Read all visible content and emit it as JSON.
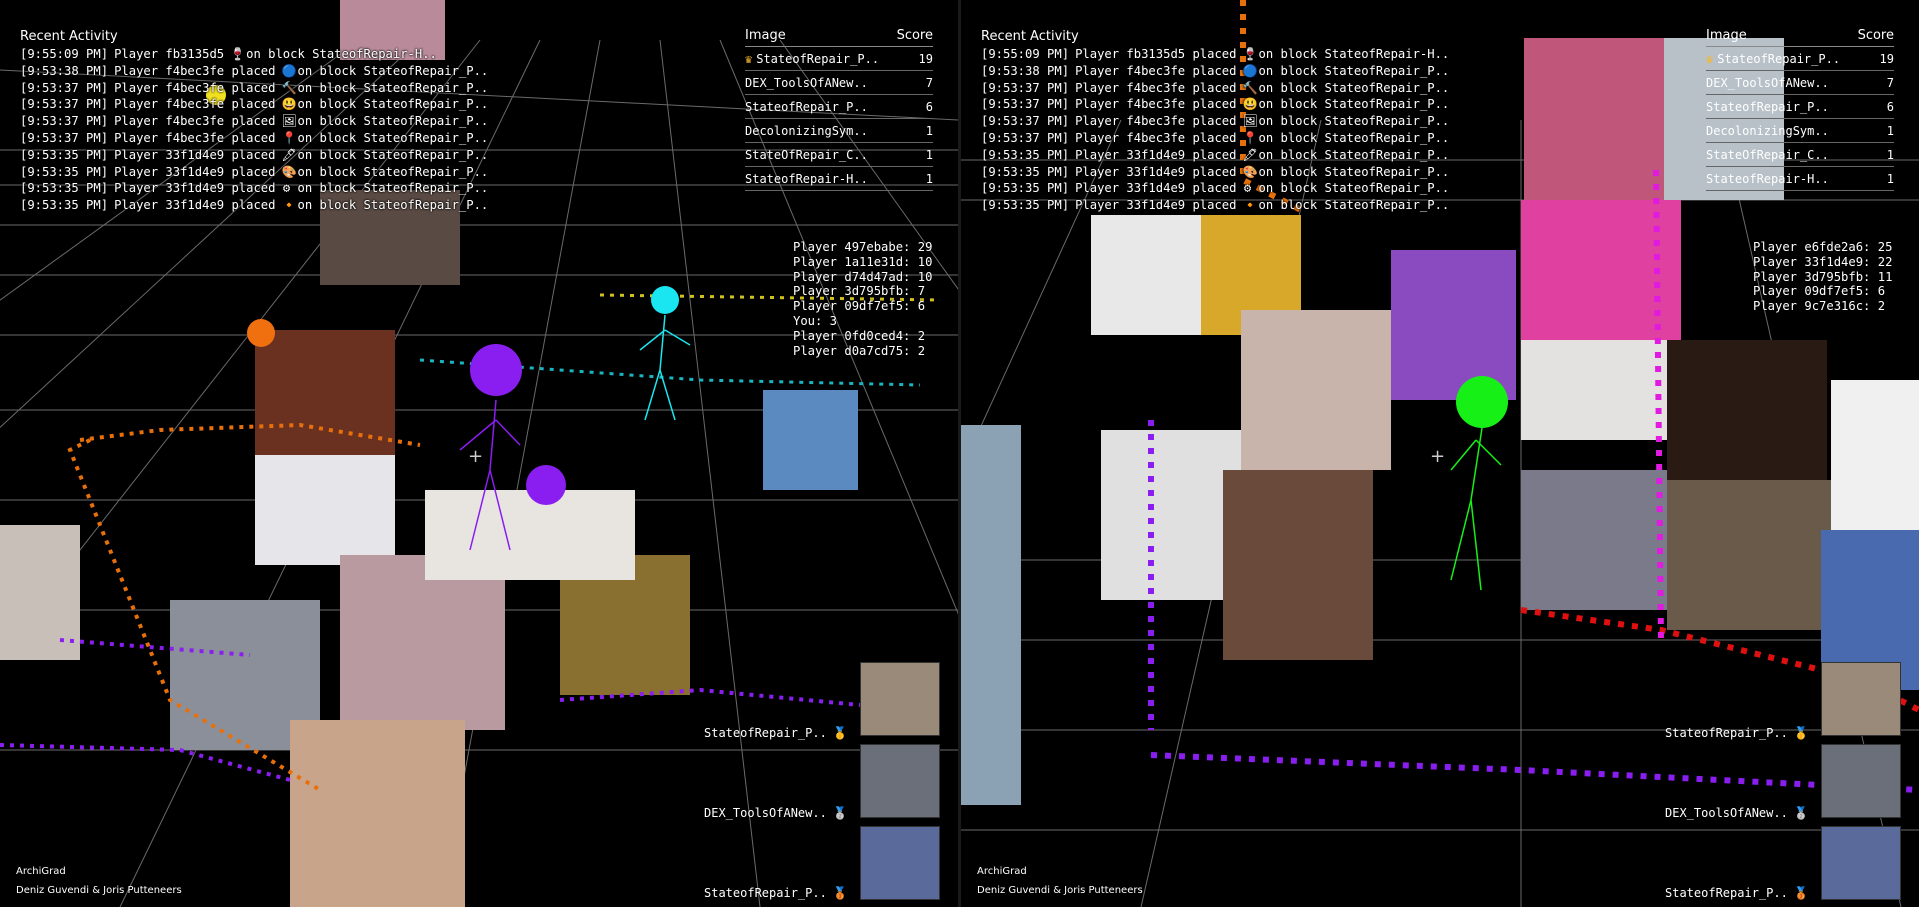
{
  "panes": [
    {
      "id": "left",
      "activity_title": "Recent Activity",
      "activity": [
        {
          "time": "[9:55:09 PM]",
          "player": "Player fb3135d5",
          "icon": "🍷",
          "block": "on block StateofRepair-H.."
        },
        {
          "time": "[9:53:38 PM]",
          "player": "Player f4bec3fe placed",
          "icon": "🔵",
          "block": "on block StateofRepair_P.."
        },
        {
          "time": "[9:53:37 PM]",
          "player": "Player f4bec3fe placed",
          "icon": "🔨",
          "block": "on block StateofRepair_P.."
        },
        {
          "time": "[9:53:37 PM]",
          "player": "Player f4bec3fe placed",
          "icon": "😃",
          "block": "on block StateofRepair_P.."
        },
        {
          "time": "[9:53:37 PM]",
          "player": "Player f4bec3fe placed",
          "icon": "🖼",
          "block": "on block StateofRepair_P.."
        },
        {
          "time": "[9:53:37 PM]",
          "player": "Player f4bec3fe placed",
          "icon": "📍",
          "block": "on block StateofRepair_P.."
        },
        {
          "time": "[9:53:35 PM]",
          "player": "Player 33f1d4e9 placed",
          "icon": "🖋",
          "block": "on block StateofRepair_P.."
        },
        {
          "time": "[9:53:35 PM]",
          "player": "Player 33f1d4e9 placed",
          "icon": "🎨",
          "block": "on block StateofRepair_P.."
        },
        {
          "time": "[9:53:35 PM]",
          "player": "Player 33f1d4e9 placed",
          "icon": "⚙",
          "block": "on block StateofRepair_P.."
        },
        {
          "time": "[9:53:35 PM]",
          "player": "Player 33f1d4e9 placed",
          "icon": "🔸",
          "block": "on block StateofRepair_P.."
        }
      ],
      "scoreboard": {
        "col_image": "Image",
        "col_score": "Score",
        "rows": [
          {
            "name": "StateofRepair_P..",
            "score": "19",
            "crown": true
          },
          {
            "name": "DEX_ToolsOfANew..",
            "score": "7",
            "crown": false
          },
          {
            "name": "StateofRepair_P..",
            "score": "6",
            "crown": false
          },
          {
            "name": "DecolonizingSym..",
            "score": "1",
            "crown": false
          },
          {
            "name": "StateOfRepair_C..",
            "score": "1",
            "crown": false
          },
          {
            "name": "StateofRepair-H..",
            "score": "1",
            "crown": false
          }
        ]
      },
      "players": [
        "Player 497ebabe: 29",
        "Player 1a11e31d: 10",
        "Player d74d47ad: 10",
        "Player 3d795bfb: 7",
        "Player 09df7ef5: 6",
        "You: 3",
        "Player 0fd0ced4: 2",
        "Player d0a7cd75: 2"
      ],
      "top_images": [
        {
          "label": "StateofRepair_P..",
          "medal": "🥇"
        },
        {
          "label": "DEX_ToolsOfANew..",
          "medal": "🥈"
        },
        {
          "label": "StateofRepair_P..",
          "medal": "🥉"
        }
      ],
      "credits": {
        "app": "ArchiGrad",
        "authors": "Deniz Guvendi & Joris Putteneers"
      },
      "crosshair": "+"
    },
    {
      "id": "right",
      "activity_title": "Recent Activity",
      "activity": [
        {
          "time": "[9:55:09 PM]",
          "player": "Player fb3135d5 placed",
          "icon": "🍷",
          "block": "on block StateofRepair-H.."
        },
        {
          "time": "[9:53:38 PM]",
          "player": "Player f4bec3fe placed",
          "icon": "🔵",
          "block": "on block StateofRepair_P.."
        },
        {
          "time": "[9:53:37 PM]",
          "player": "Player f4bec3fe placed",
          "icon": "🔨",
          "block": "on block StateofRepair_P.."
        },
        {
          "time": "[9:53:37 PM]",
          "player": "Player f4bec3fe placed",
          "icon": "😃",
          "block": "on block StateofRepair_P.."
        },
        {
          "time": "[9:53:37 PM]",
          "player": "Player f4bec3fe placed",
          "icon": "🖼",
          "block": "on block StateofRepair_P.."
        },
        {
          "time": "[9:53:37 PM]",
          "player": "Player f4bec3fe placed",
          "icon": "📍",
          "block": "on block StateofRepair_P.."
        },
        {
          "time": "[9:53:35 PM]",
          "player": "Player 33f1d4e9 placed",
          "icon": "🖋",
          "block": "on block StateofRepair_P.."
        },
        {
          "time": "[9:53:35 PM]",
          "player": "Player 33f1d4e9 placed",
          "icon": "🎨",
          "block": "on block StateofRepair_P.."
        },
        {
          "time": "[9:53:35 PM]",
          "player": "Player 33f1d4e9 placed",
          "icon": "⚙",
          "block": "on block StateofRepair_P.."
        },
        {
          "time": "[9:53:35 PM]",
          "player": "Player 33f1d4e9 placed",
          "icon": "🔸",
          "block": "on block StateofRepair_P.."
        }
      ],
      "scoreboard": {
        "col_image": "Image",
        "col_score": "Score",
        "rows": [
          {
            "name": "StateofRepair_P..",
            "score": "19",
            "crown": true
          },
          {
            "name": "DEX_ToolsOfANew..",
            "score": "7",
            "crown": false
          },
          {
            "name": "StateofRepair_P..",
            "score": "6",
            "crown": false
          },
          {
            "name": "DecolonizingSym..",
            "score": "1",
            "crown": false
          },
          {
            "name": "StateOfRepair_C..",
            "score": "1",
            "crown": false
          },
          {
            "name": "StateofRepair-H..",
            "score": "1",
            "crown": false
          }
        ]
      },
      "players": [
        "Player e6fde2a6: 25",
        "Player 33f1d4e9: 22",
        "Player 3d795bfb: 11",
        "Player 09df7ef5: 6",
        "Player 9c7e316c: 2"
      ],
      "top_images": [
        {
          "label": "StateofRepair_P..",
          "medal": "🥇"
        },
        {
          "label": "DEX_ToolsOfANew..",
          "medal": "🥈"
        },
        {
          "label": "StateofRepair_P..",
          "medal": "🥉"
        }
      ],
      "credits": {
        "app": "ArchiGrad",
        "authors": "Deniz Guvendi & Joris Putteneers"
      },
      "crosshair": "+"
    }
  ],
  "colors": {
    "background": "#000000",
    "grid": "#6a6a6a",
    "player_purple": "#8a1ef0",
    "player_cyan": "#19e6f0",
    "player_green": "#17f017",
    "trail_orange": "#e8700a",
    "trail_magenta": "#e01ae0",
    "trail_red": "#e01010",
    "crown_gold": "#f6b830"
  }
}
